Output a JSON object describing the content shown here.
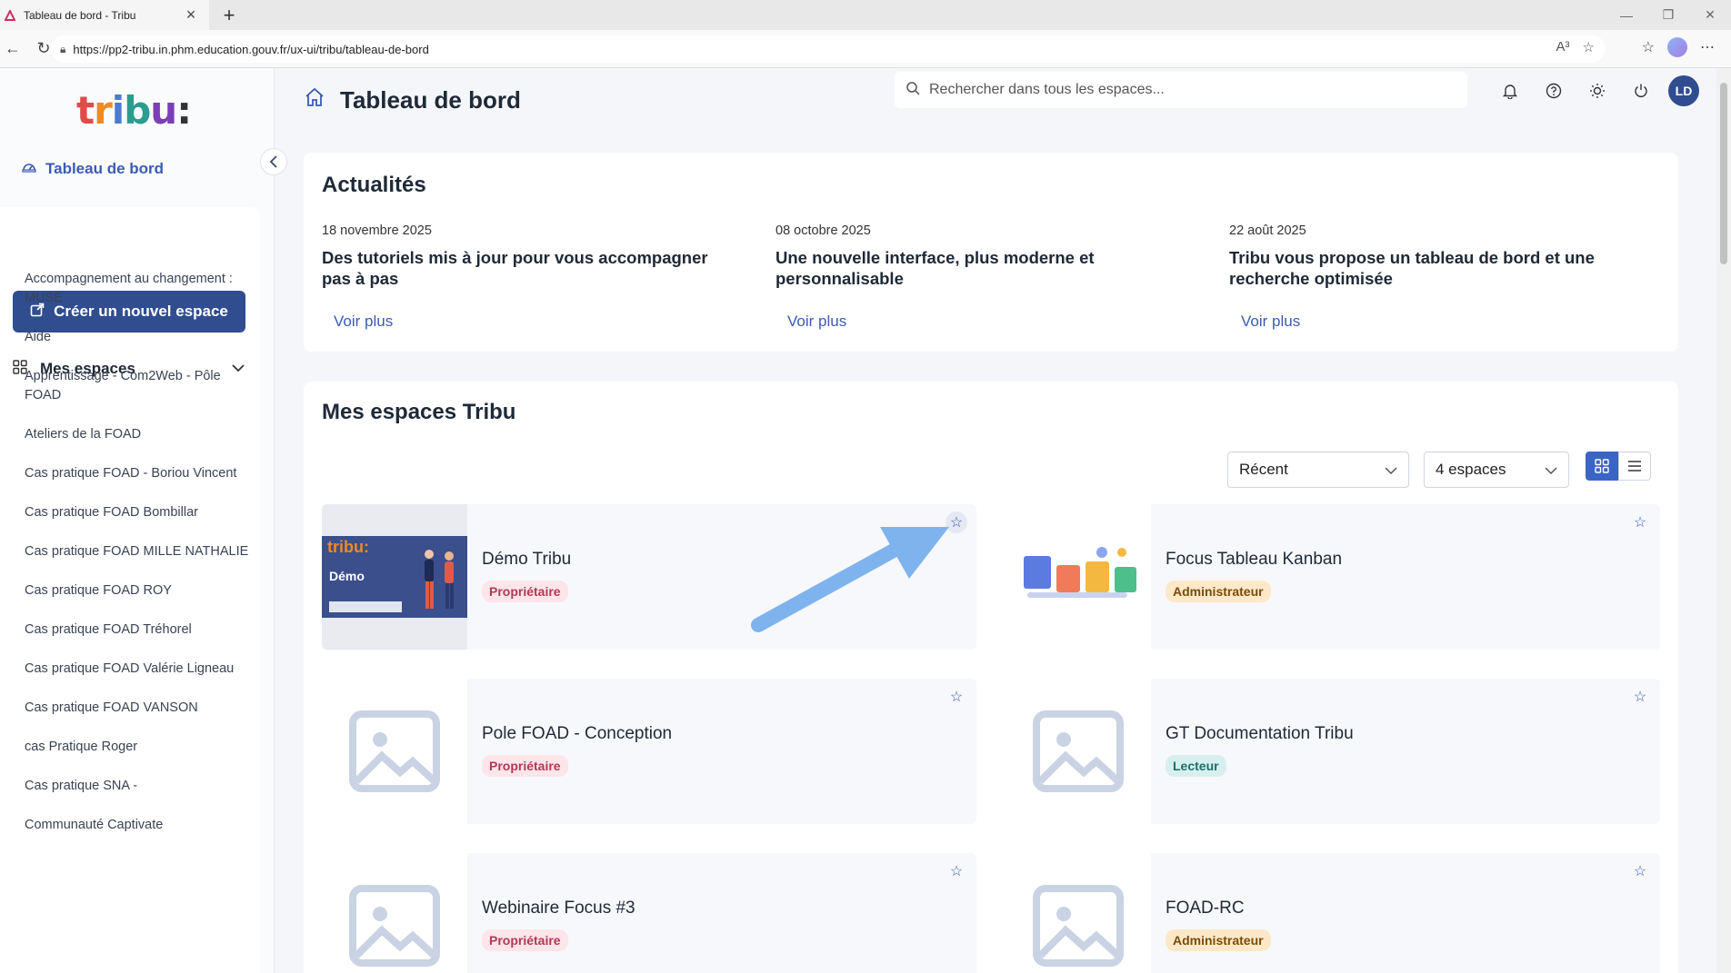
{
  "browser": {
    "tab_title": "Tableau de bord - Tribu",
    "url": "https://pp2-tribu.in.phm.education.gouv.fr/ux-ui/tribu/tableau-de-bord",
    "reader_label": "A³"
  },
  "sidebar": {
    "dashboard_label": "Tableau de bord",
    "create_button": "Créer un nouvel espace",
    "section_title": "Mes espaces",
    "items": [
      {
        "label": "Accompagnement au changement : MUSE"
      },
      {
        "label": "Aide"
      },
      {
        "label": "Apprentissage - Com2Web - Pôle FOAD"
      },
      {
        "label": "Ateliers de la FOAD"
      },
      {
        "label": "Cas pratique FOAD - Boriou Vincent"
      },
      {
        "label": "Cas pratique FOAD Bombillar"
      },
      {
        "label": "Cas pratique FOAD MILLE NATHALIE"
      },
      {
        "label": "Cas pratique FOAD ROY"
      },
      {
        "label": "Cas pratique FOAD Tréhorel"
      },
      {
        "label": "Cas pratique FOAD Valérie Ligneau"
      },
      {
        "label": "Cas pratique FOAD VANSON"
      },
      {
        "label": "cas Pratique Roger"
      },
      {
        "label": "Cas pratique SNA -"
      },
      {
        "label": "Communauté Captivate"
      }
    ]
  },
  "header": {
    "title": "Tableau de bord",
    "search_placeholder": "Rechercher dans tous les espaces...",
    "user_initials": "LD"
  },
  "news": {
    "title": "Actualités",
    "items": [
      {
        "date": "18 novembre 2025",
        "headline": "Des tutoriels mis à jour pour vous accompagner pas à pas",
        "more": "Voir plus"
      },
      {
        "date": "08 octobre 2025",
        "headline": "Une nouvelle interface, plus moderne et personnalisable",
        "more": "Voir plus"
      },
      {
        "date": "22 août 2025",
        "headline": "Tribu vous propose un tableau de bord et une recherche optimisée",
        "more": "Voir plus"
      }
    ]
  },
  "spaces": {
    "title": "Mes espaces Tribu",
    "sort_value": "Récent",
    "count_value": "4 espaces",
    "tiles": [
      {
        "name": "Démo Tribu",
        "role": "Propriétaire",
        "thumb_text": "Démo",
        "thumb_logo": "tribu:"
      },
      {
        "name": "Focus Tableau Kanban",
        "role": "Administrateur"
      },
      {
        "name": "Pole FOAD - Conception",
        "role": "Propriétaire"
      },
      {
        "name": "GT Documentation Tribu",
        "role": "Lecteur"
      },
      {
        "name": "Webinaire Focus #3",
        "role": "Propriétaire"
      },
      {
        "name": "FOAD-RC",
        "role": "Administrateur"
      }
    ]
  },
  "colors": {
    "primary": "#2f4d8f",
    "link": "#3b5bb5",
    "arrow": "#7fb3ee"
  }
}
